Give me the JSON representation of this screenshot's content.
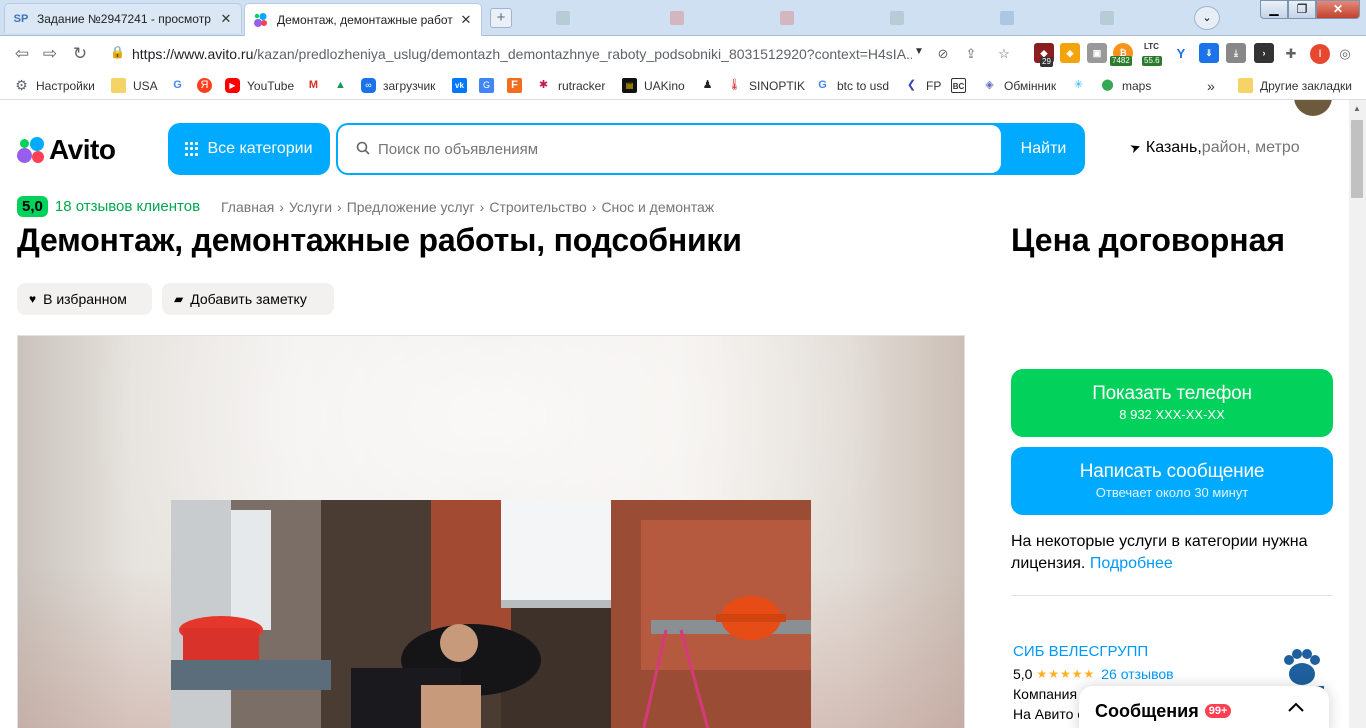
{
  "browser": {
    "tabs": [
      {
        "favicon": "SP",
        "title": "Задание №2947241 - просмотр з",
        "close": "✕"
      },
      {
        "favicon": "avito-dots",
        "title": "Демонтаж, демонтажные работы",
        "close": "✕"
      }
    ],
    "new_tab": "+",
    "url_host": "https://www.avito.ru",
    "url_path": "/kazan/predlozheniya_uslug/demontazh_demontazhnye_raboty_podsobniki_8031512920?context=H4sIA...",
    "extensions": {
      "badge_29": "29",
      "ltc_label": "LTC",
      "price_7482": "7482",
      "price_55_6": "55.6",
      "profile_initial": "I"
    },
    "bookmarks": [
      {
        "label": "Настройки",
        "icon": "gear-icon"
      },
      {
        "label": "USA",
        "icon": "folder-icon"
      },
      {
        "label": "",
        "icon": "google-icon"
      },
      {
        "label": "",
        "icon": "yandex-icon"
      },
      {
        "label": "YouTube",
        "icon": "youtube-icon"
      },
      {
        "label": "",
        "icon": "gmail-icon"
      },
      {
        "label": "",
        "icon": "drive-icon"
      },
      {
        "label": "загрузчик",
        "icon": "loader-icon"
      },
      {
        "label": "",
        "icon": "vk-icon"
      },
      {
        "label": "",
        "icon": "translate-icon"
      },
      {
        "label": "",
        "icon": "f-icon"
      },
      {
        "label": "rutracker",
        "icon": "rutracker-icon"
      },
      {
        "label": "UAKino",
        "icon": "uakino-icon"
      },
      {
        "label": "",
        "icon": "figure-icon"
      },
      {
        "label": "SINOPTIK",
        "icon": "thermometer-icon"
      },
      {
        "label": "btc to usd",
        "icon": "google-icon"
      },
      {
        "label": "FP",
        "icon": "fp-icon"
      },
      {
        "label": "",
        "icon": "bc-icon"
      },
      {
        "label": "Обмінник",
        "icon": "exchange-icon"
      },
      {
        "label": "",
        "icon": "star-burst-icon"
      },
      {
        "label": "maps",
        "icon": "maps-icon"
      }
    ],
    "bookmarks_more": "»",
    "other_bookmarks": "Другие закладки"
  },
  "header": {
    "logo": "Avito",
    "all_categories": "Все категории",
    "search_placeholder": "Поиск по объявлениям",
    "search_button": "Найти",
    "location_city": "Казань,",
    "location_rest": " район, метро"
  },
  "listing": {
    "rating_score": "5,0",
    "reviews_link": "18 отзывов клиентов",
    "breadcrumbs": [
      "Главная",
      "Услуги",
      "Предложение услуг",
      "Строительство",
      "Снос и демонтаж"
    ],
    "breadcrumb_sep": "›",
    "title": "Демонтаж, демонтажные работы, подсобники",
    "price": "Цена договорная",
    "favorite_label": "В избранном",
    "note_label": "Добавить заметку"
  },
  "actions": {
    "show_phone": "Показать телефон",
    "phone_masked": "8 932 XXX-XX-XX",
    "write_message": "Написать сообщение",
    "response_time": "Отвечает около 30 минут",
    "license_text": "На некоторые услуги в категории нужна лицензия. ",
    "license_link": "Подробнее"
  },
  "seller": {
    "name": "СИБ ВЕЛЕСГРУПП",
    "rating": "5,0",
    "stars": "★★★★★",
    "reviews": "26 отзывов",
    "type": "Компания",
    "since": "На Авито с"
  },
  "messenger": {
    "title": "Сообщения",
    "badge": "99+",
    "chevron": "⌃"
  },
  "colors": {
    "avito_blue": "#00aaff",
    "avito_green": "#02d15c",
    "link_blue": "#0099f7",
    "badge_red": "#ff4053"
  }
}
